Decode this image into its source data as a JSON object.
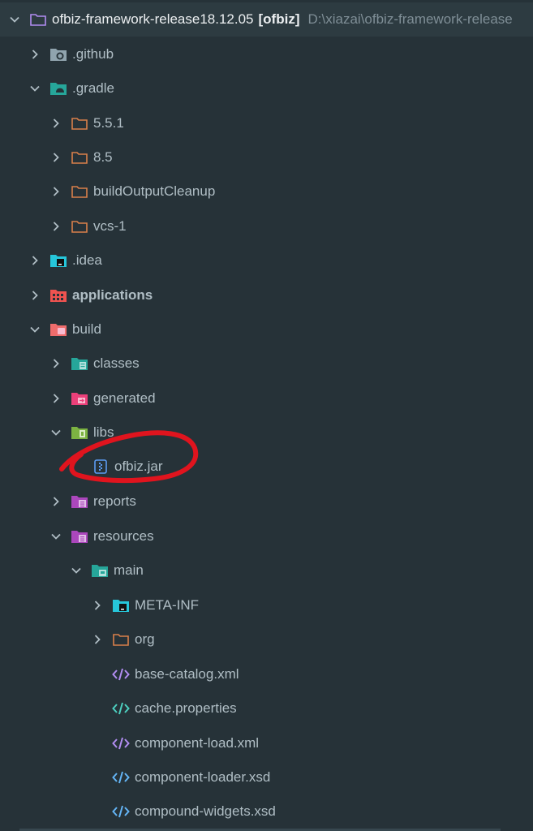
{
  "root": {
    "label": "ofbiz-framework-release18.12.05",
    "module": "[ofbiz]",
    "path": "D:\\xiazai\\ofbiz-framework-release"
  },
  "items": [
    {
      "label": ".github",
      "icon": "github-folder-icon",
      "expanded": false
    },
    {
      "label": ".gradle",
      "icon": "gradle-folder-icon",
      "expanded": true
    },
    {
      "label": "5.5.1",
      "icon": "folder-icon",
      "expanded": false
    },
    {
      "label": "8.5",
      "icon": "folder-icon",
      "expanded": false
    },
    {
      "label": "buildOutputCleanup",
      "icon": "folder-icon",
      "expanded": false
    },
    {
      "label": "vcs-1",
      "icon": "folder-icon",
      "expanded": false
    },
    {
      "label": ".idea",
      "icon": "idea-folder-icon",
      "expanded": false
    },
    {
      "label": "applications",
      "icon": "applications-folder-icon",
      "expanded": false
    },
    {
      "label": "build",
      "icon": "build-folder-icon",
      "expanded": true
    },
    {
      "label": "classes",
      "icon": "classes-folder-icon",
      "expanded": false
    },
    {
      "label": "generated",
      "icon": "generated-folder-icon",
      "expanded": false
    },
    {
      "label": "libs",
      "icon": "libs-folder-icon",
      "expanded": true
    },
    {
      "label": "ofbiz.jar",
      "icon": "jar-file-icon"
    },
    {
      "label": "reports",
      "icon": "reports-folder-icon",
      "expanded": false
    },
    {
      "label": "resources",
      "icon": "resources-folder-icon",
      "expanded": true
    },
    {
      "label": "main",
      "icon": "main-folder-icon",
      "expanded": true
    },
    {
      "label": "META-INF",
      "icon": "meta-inf-folder-icon",
      "expanded": false
    },
    {
      "label": "org",
      "icon": "folder-icon",
      "expanded": false
    },
    {
      "label": "base-catalog.xml",
      "icon": "xml-file-icon"
    },
    {
      "label": "cache.properties",
      "icon": "properties-file-icon"
    },
    {
      "label": "component-load.xml",
      "icon": "xml-file-icon"
    },
    {
      "label": "component-loader.xsd",
      "icon": "xsd-file-icon"
    },
    {
      "label": "compound-widgets.xsd",
      "icon": "xsd-file-icon"
    }
  ],
  "colors": {
    "background": "#263238",
    "text": "#B0BEC5",
    "annotation": "#E0141E"
  }
}
